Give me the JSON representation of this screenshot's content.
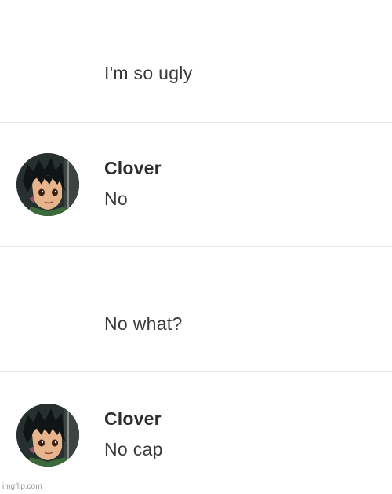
{
  "thread": {
    "messages": [
      {
        "username": "",
        "text": "I'm so ugly",
        "has_avatar": false
      },
      {
        "username": "Clover",
        "text": "No",
        "has_avatar": true,
        "avatar_icon": "anime-boy-avatar-icon"
      },
      {
        "username": "",
        "text": "No what?",
        "has_avatar": false
      },
      {
        "username": "Clover",
        "text": "No cap",
        "has_avatar": true,
        "avatar_icon": "anime-boy-avatar-icon"
      }
    ]
  },
  "watermark": "imgflip.com",
  "colors": {
    "background": "#ffffff",
    "divider": "#e8e8e8",
    "username": "#2d2d2d",
    "message_text": "#3a3a3a"
  }
}
